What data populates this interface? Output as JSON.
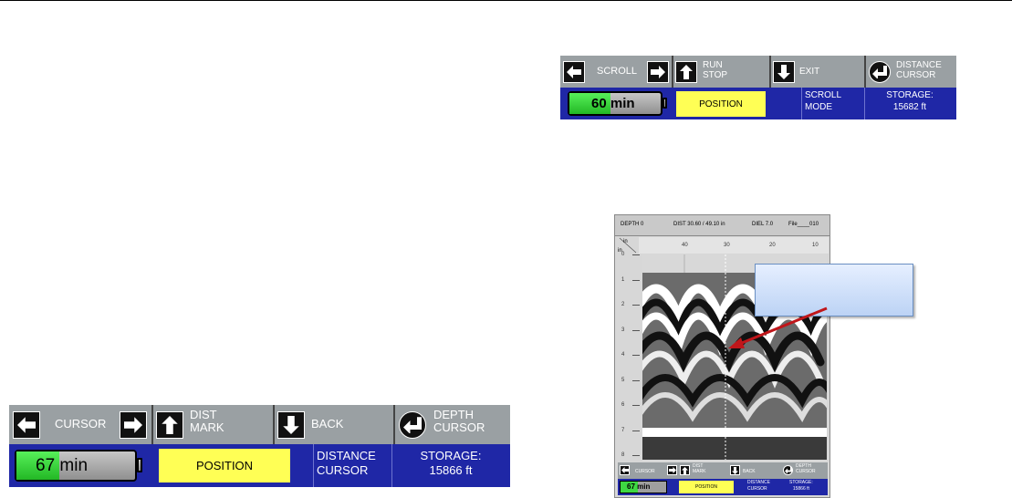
{
  "colors": {
    "panel_blue": "#1f27a6",
    "button_gray": "#9aa0a3",
    "position_yellow": "#ffff55",
    "battery_green": "#3ed842",
    "arrow_red": "#c0161a"
  },
  "icons": {
    "left": "arrow-left-icon",
    "right": "arrow-right-icon",
    "up": "arrow-up-icon",
    "down": "arrow-down-icon",
    "enter": "enter-return-icon"
  },
  "scroll_panel": {
    "left_label": "SCROLL",
    "up_label_1": "RUN",
    "up_label_2": "STOP",
    "down_label": "EXIT",
    "enter_label_1": "DISTANCE",
    "enter_label_2": "CURSOR",
    "battery_text": "60 min",
    "battery_level": 0.45,
    "position_label": "POSITION",
    "mode_line_1": "SCROLL",
    "mode_line_2": "MODE",
    "storage_line_1": "STORAGE:",
    "storage_line_2": "15682 ft"
  },
  "cursor_panel": {
    "left_label": "CURSOR",
    "up_label_1": "DIST",
    "up_label_2": "MARK",
    "down_label": "BACK",
    "enter_label_1": "DEPTH",
    "enter_label_2": "CURSOR",
    "battery_text": "67 min",
    "battery_level": 0.36,
    "position_label": "POSITION",
    "mode_line_1": "DISTANCE",
    "mode_line_2": "CURSOR",
    "storage_line_1": "STORAGE:",
    "storage_line_2": "15866 ft"
  },
  "device": {
    "header": {
      "depth": "DEPTH 0",
      "dist": "DIST 30.60 / 49.10 in",
      "diel": "DIEL 7.0",
      "file": "File____010"
    },
    "units_x": "in",
    "units_y": "in",
    "x_ticks": [
      "40",
      "30",
      "20",
      "10"
    ],
    "y_ticks": [
      "0",
      "1",
      "2",
      "3",
      "4",
      "5",
      "6",
      "7",
      "8"
    ],
    "mini_panel": {
      "left_label": "CURSOR",
      "up_label_1": "DIST",
      "up_label_2": "MARK",
      "down_label": "BACK",
      "enter_label_1": "DEPTH",
      "enter_label_2": "CURSOR",
      "battery_text": "67 min",
      "position_label": "POSITION",
      "mode_line_1": "DISTANCE",
      "mode_line_2": "CURSOR",
      "storage_line_1": "STORAGE:",
      "storage_line_2": "15866 ft"
    }
  }
}
